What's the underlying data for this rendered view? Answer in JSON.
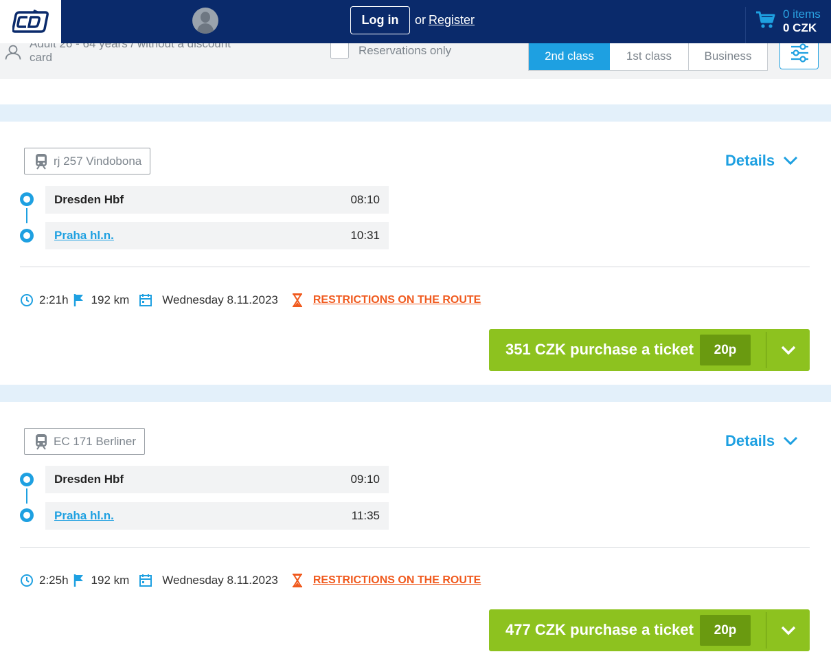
{
  "header": {
    "logo_text": "ČD",
    "login_label": "Log in",
    "or_text": "or",
    "register_label": "Register",
    "cart_items": "0 items",
    "cart_total": "0 CZK"
  },
  "filters": {
    "passenger": "Adult 26 - 64 years / without a discount card",
    "reservations_label": "Reservations only",
    "classes": [
      "2nd class",
      "1st class",
      "Business"
    ],
    "active_class": "2nd class"
  },
  "connections": [
    {
      "train": "rj 257 Vindobona",
      "details_label": "Details",
      "from": {
        "station": "Dresden Hbf",
        "time": "08:10"
      },
      "to": {
        "station": "Praha hl.n.",
        "time": "10:31"
      },
      "duration": "2:21h",
      "distance": "192 km",
      "date": "Wednesday 8.11.2023",
      "restrictions": "RESTRICTIONS ON THE ROUTE",
      "buy_label": "351 CZK purchase a ticket",
      "seats": "20p"
    },
    {
      "train": "EC 171 Berliner",
      "details_label": "Details",
      "from": {
        "station": "Dresden Hbf",
        "time": "09:10"
      },
      "to": {
        "station": "Praha hl.n.",
        "time": "11:35"
      },
      "duration": "2:25h",
      "distance": "192 km",
      "date": "Wednesday 8.11.2023",
      "restrictions": "RESTRICTIONS ON THE ROUTE",
      "buy_label": "477 CZK purchase a ticket",
      "seats": "20p"
    }
  ],
  "colors": {
    "header_bg": "#0a2a6b",
    "accent_blue": "#1ea0e1",
    "buy_green": "#8dc21f",
    "warning_orange": "#f05a1e"
  },
  "icons": [
    "cd-logo-icon",
    "user-avatar-icon",
    "cart-icon",
    "passenger-icon",
    "settings-sliders-icon",
    "train-icon",
    "chevron-down-icon",
    "clock-icon",
    "flag-icon",
    "calendar-icon",
    "hourglass-icon"
  ]
}
